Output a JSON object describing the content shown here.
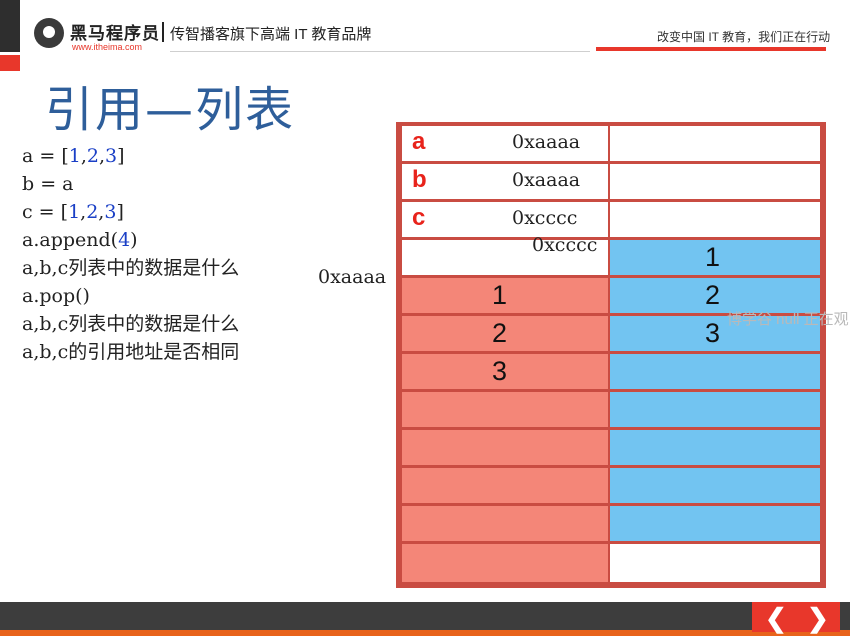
{
  "header": {
    "brand_name": "黑马程序员",
    "brand_url": "www.itheima.com",
    "tagline": "传智播客旗下高端 IT 教育品牌",
    "slogan": "改变中国 IT 教育，我们正在行动"
  },
  "title": "引用—列表",
  "code": {
    "l1_a": "a = [",
    "l1_n1": "1",
    "l1_c1": ",",
    "l1_n2": "2",
    "l1_c2": ",",
    "l1_n3": "3",
    "l1_end": "]",
    "l2": "b = a",
    "l3_a": "c = [",
    "l3_n1": "1",
    "l3_c1": ",",
    "l3_n2": "2",
    "l3_c2": ",",
    "l3_n3": "3",
    "l3_end": "]",
    "l4_a": "a.append(",
    "l4_n": "4",
    "l4_end": ")",
    "l5": "a,b,c列表中的数据是什么",
    "l6": "a.pop()",
    "l7": "a,b,c列表中的数据是什么",
    "l8": "a,b,c的引用地址是否相同"
  },
  "memory": {
    "var_a": "a",
    "var_b": "b",
    "var_c": "c",
    "addr_a": "0xaaaa",
    "addr_b": "0xaaaa",
    "addr_c": "0xcccc",
    "right_list_addr": "0xcccc",
    "left_list_addr": "0xaaaa",
    "left_values": [
      "1",
      "2",
      "3"
    ],
    "right_values": [
      "1",
      "2",
      "3"
    ]
  },
  "watermark": "博学谷 null 正在观",
  "nav": {
    "prev": "❮",
    "next": "❯"
  },
  "colors": {
    "red_cell": "#f48678",
    "blue_cell": "#72c4f1",
    "frame": "#c94c42",
    "accent": "#e8372b",
    "title": "#2e5e9a"
  }
}
